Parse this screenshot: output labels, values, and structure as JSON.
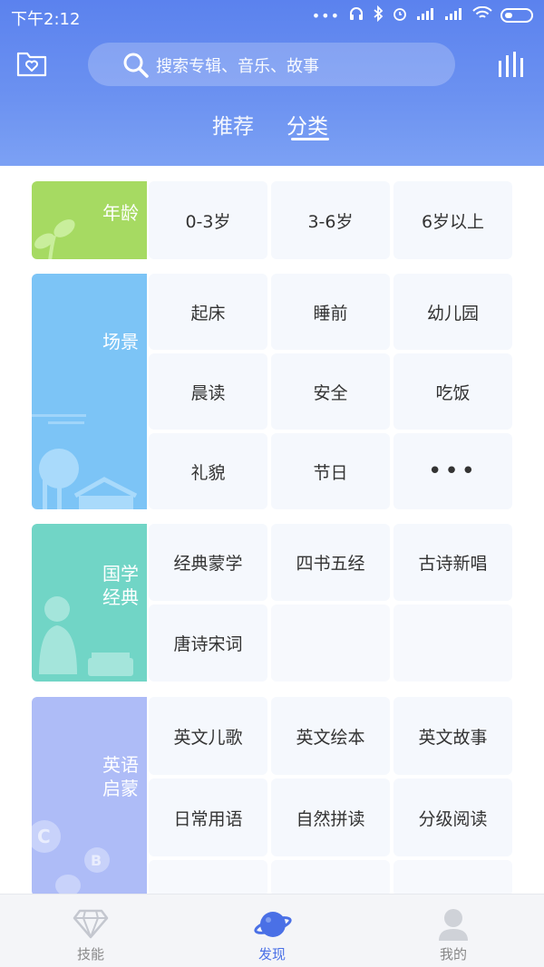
{
  "status_bar": {
    "time": "下午2:12",
    "dots": "•••"
  },
  "header": {
    "search_placeholder": "搜索专辑、音乐、故事",
    "tabs": [
      {
        "label": "推荐",
        "active": false
      },
      {
        "label": "分类",
        "active": true
      }
    ]
  },
  "sections": {
    "age": {
      "title": "年龄",
      "items": [
        "0-3岁",
        "3-6岁",
        "6岁以上"
      ]
    },
    "scene": {
      "title": "场景",
      "items": [
        "起床",
        "睡前",
        "幼儿园",
        "晨读",
        "安全",
        "吃饭",
        "礼貌",
        "节日",
        "•••"
      ]
    },
    "guoxue": {
      "title_line1": "国学",
      "title_line2": "经典",
      "items": [
        "经典蒙学",
        "四书五经",
        "古诗新唱",
        "唐诗宋词"
      ]
    },
    "english": {
      "title_line1": "英语",
      "title_line2": "启蒙",
      "items": [
        "英文儿歌",
        "英文绘本",
        "英文故事",
        "日常用语",
        "自然拼读",
        "分级阅读"
      ]
    }
  },
  "bottom_nav": [
    {
      "label": "技能",
      "icon": "diamond-icon",
      "active": false
    },
    {
      "label": "发现",
      "icon": "planet-icon",
      "active": true
    },
    {
      "label": "我的",
      "icon": "user-icon",
      "active": false
    }
  ],
  "colors": {
    "header": "#6c92f1",
    "age": "#a6da62",
    "scene": "#7cc4f6",
    "guoxue": "#71d5c6",
    "english": "#aebcf7",
    "active_nav": "#4a70e6"
  }
}
